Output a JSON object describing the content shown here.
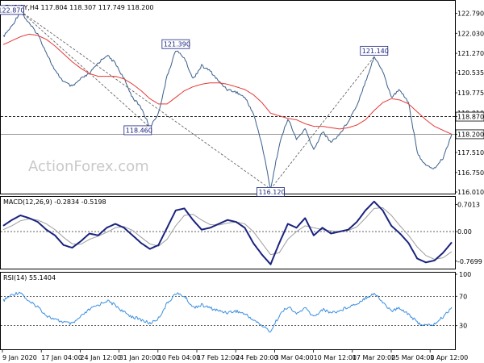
{
  "price_header": "EURJPY,H4 117.804 118.307 117.749 118.200",
  "macd_header": "MACD(12,26,9) -0.2834 -0.5198",
  "rsi_header": "RSI(14) 55.1404",
  "watermark": "ActionForex.com",
  "colors": {
    "price": "#3a5f8a",
    "ma": "#e53935",
    "trendline": "#555555",
    "macd": "#1a237e",
    "signal": "#9e9e9e",
    "rsi": "#3b8fe0",
    "label_border": "#1a237e",
    "level_line": "#888888"
  },
  "chart_data": [
    {
      "type": "line",
      "panel": "price",
      "title": "EURJPY,H4",
      "ylim": [
        116.01,
        123.11
      ],
      "y_ticks": [
        "122.790",
        "122.030",
        "121.270",
        "120.535",
        "119.775",
        "119.010",
        "118.870",
        "118.200",
        "117.510",
        "116.750",
        "116.010"
      ],
      "x_ticks": [
        "9 Jan 2020",
        "17 Jan 04:00",
        "24 Jan 12:00",
        "31 Jan 20:00",
        "10 Feb 04:00",
        "17 Feb 12:00",
        "24 Feb 20:00",
        "3 Mar 04:00",
        "10 Mar 12:00",
        "17 Mar 20:00",
        "25 Mar 04:00",
        "1 Apr 12:00"
      ],
      "series": [
        {
          "values": [
            121.9,
            122.3,
            122.87,
            122.4,
            122.0,
            121.3,
            120.6,
            120.2,
            120.0,
            120.3,
            120.5,
            120.9,
            121.2,
            120.9,
            120.3,
            119.6,
            119.2,
            118.46,
            119.0,
            120.4,
            121.39,
            121.1,
            120.3,
            120.8,
            120.6,
            120.2,
            119.9,
            119.8,
            119.6,
            119.0,
            117.8,
            116.12,
            117.8,
            118.8,
            118.0,
            118.4,
            117.6,
            118.3,
            117.9,
            118.2,
            118.7,
            119.3,
            120.2,
            121.14,
            120.6,
            119.6,
            119.9,
            119.4,
            117.5,
            117.0,
            116.9,
            117.3,
            118.2
          ]
        },
        {
          "name": "MA",
          "values": [
            121.6,
            121.75,
            121.9,
            122.0,
            121.95,
            121.8,
            121.55,
            121.25,
            120.95,
            120.7,
            120.5,
            120.4,
            120.4,
            120.4,
            120.3,
            120.1,
            119.85,
            119.55,
            119.35,
            119.35,
            119.6,
            119.85,
            120.0,
            120.1,
            120.15,
            120.15,
            120.1,
            120.0,
            119.9,
            119.7,
            119.4,
            119.0,
            118.9,
            118.8,
            118.75,
            118.6,
            118.5,
            118.5,
            118.45,
            118.4,
            118.45,
            118.55,
            118.75,
            119.1,
            119.4,
            119.55,
            119.5,
            119.35,
            119.05,
            118.75,
            118.5,
            118.35,
            118.2
          ]
        }
      ],
      "annotations": [
        {
          "text": "122.870",
          "x_index": 2,
          "y": 122.87
        },
        {
          "text": "121.390",
          "x_index": 20,
          "y": 121.39
        },
        {
          "text": "118.460",
          "x_index": 17,
          "y": 118.46
        },
        {
          "text": "116.120",
          "x_index": 31,
          "y": 116.12
        },
        {
          "text": "121.140",
          "x_index": 43,
          "y": 121.14
        }
      ],
      "current_price": "118.200",
      "horizontal_level": "118.870"
    },
    {
      "type": "line",
      "panel": "macd",
      "title": "MACD(12,26,9)",
      "ylim": [
        -0.92,
        0.86
      ],
      "y_ticks": [
        "0.7013",
        "0.00",
        "-0.7699"
      ],
      "series": [
        {
          "name": "MACD",
          "values": [
            0.15,
            0.3,
            0.42,
            0.35,
            0.25,
            0.05,
            -0.1,
            -0.35,
            -0.42,
            -0.25,
            -0.05,
            -0.1,
            0.1,
            0.2,
            0.1,
            -0.1,
            -0.3,
            -0.45,
            -0.35,
            0.1,
            0.55,
            0.6,
            0.3,
            0.05,
            0.1,
            0.2,
            0.3,
            0.25,
            0.1,
            -0.3,
            -0.6,
            -0.85,
            -0.3,
            0.2,
            0.1,
            0.35,
            -0.1,
            0.1,
            -0.05,
            0.0,
            0.05,
            0.25,
            0.55,
            0.78,
            0.55,
            0.15,
            -0.05,
            -0.3,
            -0.7,
            -0.8,
            -0.75,
            -0.55,
            -0.28
          ]
        },
        {
          "name": "Signal",
          "values": [
            0.05,
            0.15,
            0.28,
            0.33,
            0.3,
            0.2,
            0.05,
            -0.15,
            -0.32,
            -0.33,
            -0.2,
            -0.12,
            -0.02,
            0.1,
            0.13,
            0.03,
            -0.15,
            -0.32,
            -0.38,
            -0.2,
            0.15,
            0.42,
            0.45,
            0.3,
            0.18,
            0.17,
            0.22,
            0.25,
            0.2,
            0.0,
            -0.3,
            -0.6,
            -0.55,
            -0.2,
            0.0,
            0.15,
            0.1,
            0.05,
            0.02,
            0.0,
            0.03,
            0.12,
            0.35,
            0.6,
            0.62,
            0.42,
            0.15,
            -0.1,
            -0.4,
            -0.62,
            -0.72,
            -0.68,
            -0.52
          ]
        }
      ]
    },
    {
      "type": "line",
      "panel": "rsi",
      "title": "RSI(14)",
      "ylim": [
        0,
        100
      ],
      "y_ticks": [
        "100",
        "70",
        "30",
        "0"
      ],
      "series": [
        {
          "values": [
            64,
            72,
            76,
            62,
            56,
            44,
            38,
            35,
            32,
            42,
            52,
            58,
            64,
            58,
            48,
            42,
            38,
            33,
            40,
            60,
            74,
            70,
            55,
            58,
            54,
            50,
            48,
            50,
            46,
            38,
            30,
            22,
            44,
            56,
            46,
            54,
            42,
            52,
            48,
            50,
            56,
            60,
            68,
            74,
            62,
            50,
            54,
            46,
            34,
            30,
            32,
            42,
            55
          ]
        }
      ]
    }
  ]
}
